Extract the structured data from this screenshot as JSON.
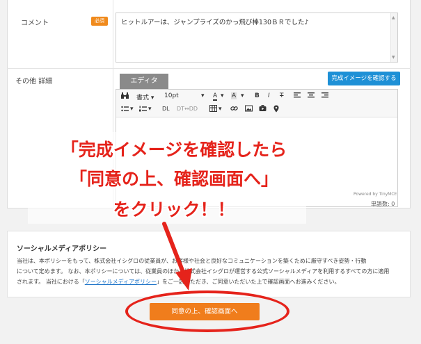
{
  "form": {
    "comment_label": "コメント",
    "required_badge": "必須",
    "comment_value": "ヒットルアーは、ジャンプライズのかっ飛び棒130ＢＲでした♪",
    "other_label": "その他 詳細",
    "editor_tab": "エディタ",
    "preview_button": "完成イメージを確認する"
  },
  "toolbar": {
    "binoculars_icon": "🔍",
    "format_select": "書式",
    "fontsize_select": "10pt",
    "font_color": "A",
    "bg_color": "A",
    "bold": "B",
    "italic": "I",
    "strike": "T",
    "dl": "DL",
    "dtdd": "DT↔DD",
    "dropdown_caret": "▾"
  },
  "editor": {
    "powered_by": "Powered by TinyMCE",
    "word_count": "単語数: 0"
  },
  "policy": {
    "title": "ソーシャルメディアポリシー",
    "line1": "当社は、本ポリシーをもって、株式会社イシグロの従業員が、お客様や社会と良好なコミュニケーションを築くために厳守すべき姿勢・行動",
    "line2": "について定めます。 なお、本ポリシーについては、従業員のほか、株式会社イシグロが運営する公式ソーシャルメディアを利用するすべての方に適用",
    "line3_pre": "されます。 当社における「",
    "line3_link": "ソーシャルメディアポリシー",
    "line3_post": "」をご一読いただき、ご同意いただいた上で確認画面へお進みください。"
  },
  "agree_button": "同意の上、確認画面へ",
  "annotation": {
    "line1": "「完成イメージを確認したら",
    "line2": "「同意の上、確認画面へ」",
    "line3": "をクリック！！"
  },
  "colors": {
    "accent_orange": "#f07d1c",
    "link_blue": "#1e74c8",
    "annotation_red": "#e5231b"
  }
}
